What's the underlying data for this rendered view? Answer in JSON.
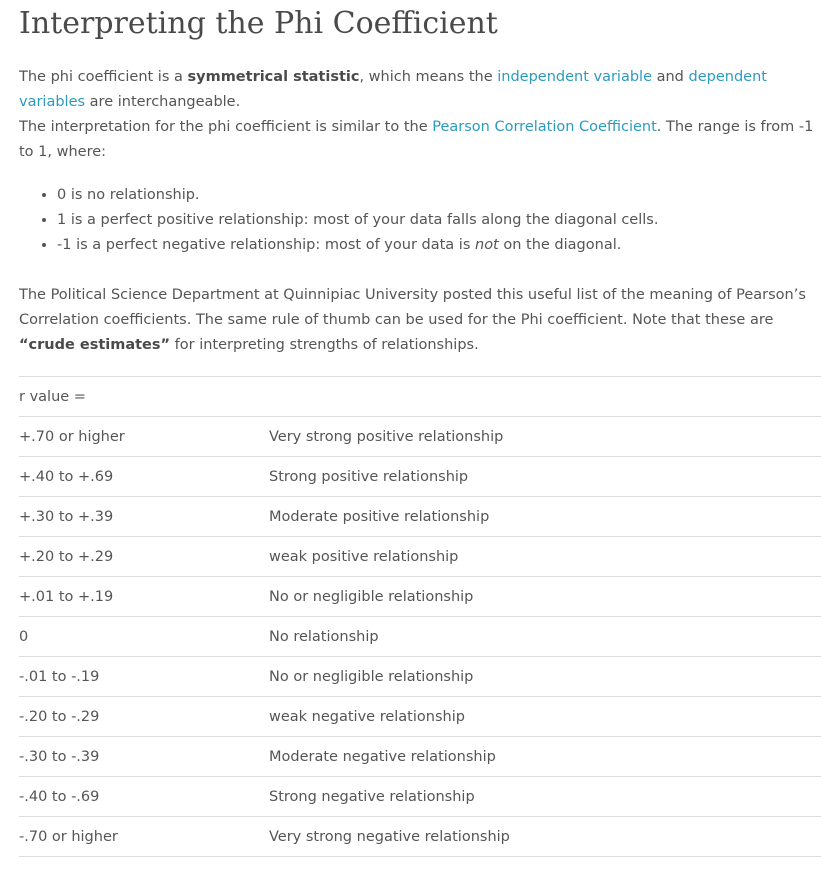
{
  "title": "Interpreting the Phi Coefficient",
  "intro": {
    "l1_a": "The phi coefficient is a ",
    "l1_bold": "symmetrical statistic",
    "l1_b": ", which means the ",
    "l1_link1": "independent variable",
    "l1_c": " and ",
    "l1_link2": "dependent variables",
    "l1_d": " are interchangeable.",
    "l2_a": "The interpretation for the phi coefficient is similar to the ",
    "l2_link": "Pearson Correlation Coefficient",
    "l2_b": ". The range is from -1 to 1, where:"
  },
  "bullets": {
    "b1": "0 is no relationship.",
    "b2": "1 is a perfect positive relationship: most of your data falls along the diagonal cells.",
    "b3_a": "-1 is a perfect negative relationship: most of your data is ",
    "b3_em": "not",
    "b3_b": " on the diagonal."
  },
  "para2": {
    "a": "The Political Science Department at Quinnipiac University posted this useful list of the meaning of Pearson’s Correlation coefficients. The same rule of thumb can be used for the Phi coefficient. Note that these are ",
    "bold": "“crude estimates”",
    "b": " for interpreting strengths of relationships."
  },
  "table": {
    "header": "r value =",
    "rows": [
      {
        "range": "+.70 or higher",
        "meaning": "Very strong positive relationship"
      },
      {
        "range": "+.40 to +.69",
        "meaning": "Strong positive relationship"
      },
      {
        "range": "+.30 to +.39",
        "meaning": "Moderate positive relationship"
      },
      {
        "range": "+.20 to +.29",
        "meaning": "weak positive relationship"
      },
      {
        "range": "+.01 to +.19",
        "meaning": "No or negligible relationship"
      },
      {
        "range": "0",
        "meaning": "No relationship"
      },
      {
        "range": "-.01 to -.19",
        "meaning": "No or negligible relationship"
      },
      {
        "range": "-.20 to -.29",
        "meaning": "weak negative relationship"
      },
      {
        "range": "-.30 to -.39",
        "meaning": "Moderate negative relationship"
      },
      {
        "range": "-.40 to -.69",
        "meaning": "Strong negative relationship"
      },
      {
        "range": "-.70 or higher",
        "meaning": "Very strong negative relationship"
      }
    ]
  },
  "colors": {
    "link": "#2b9bbd",
    "text": "#555555",
    "rule": "#dddddd"
  }
}
